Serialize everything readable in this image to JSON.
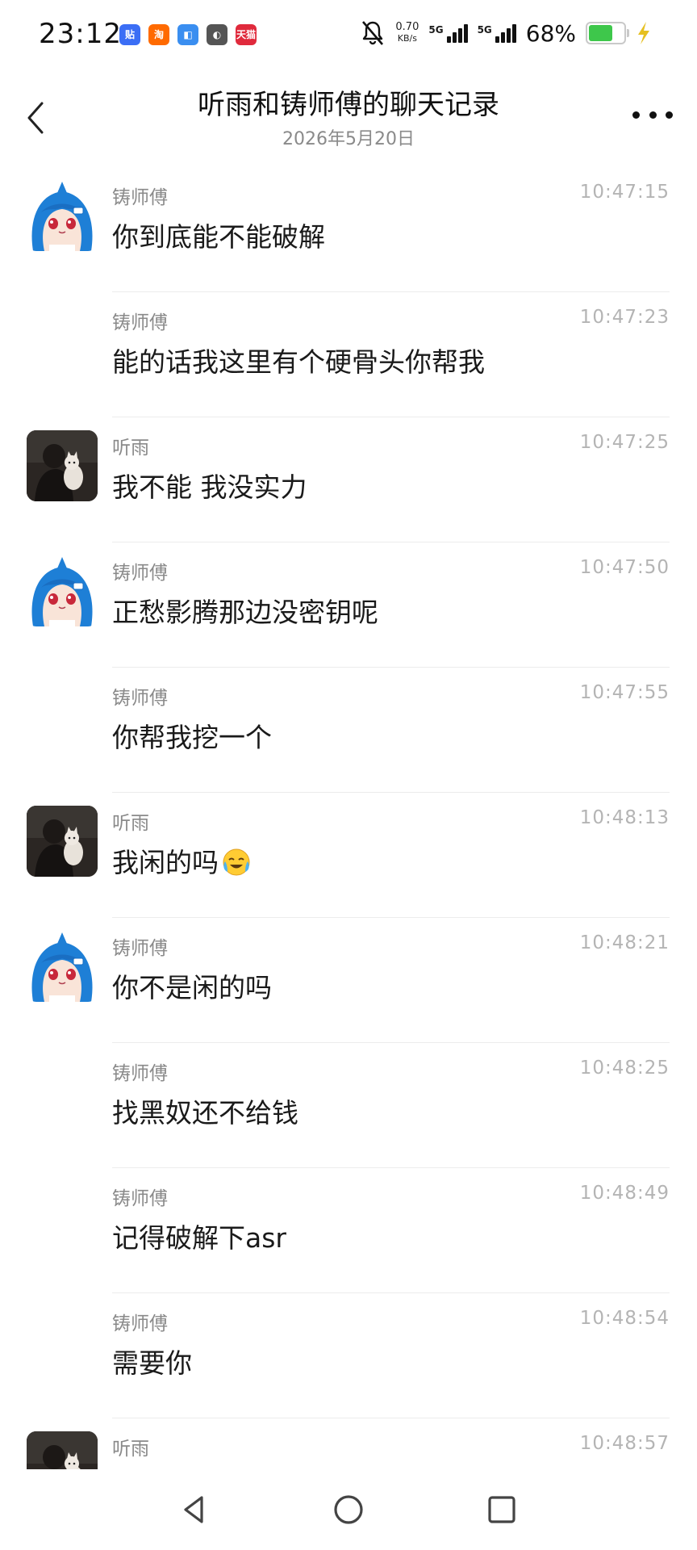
{
  "status_bar": {
    "time": "23:12",
    "apps": [
      {
        "label": "贴",
        "color": "#3b6ef5",
        "icon": "tieba-app-icon"
      },
      {
        "label": "淘",
        "color": "#ff6a00",
        "icon": "taobao-app-icon"
      },
      {
        "label": "◧",
        "color": "#3a8ef0",
        "icon": "message-app-icon"
      },
      {
        "label": "◐",
        "color": "#555555",
        "icon": "app-icon"
      },
      {
        "label": "天猫",
        "color": "#e02a3c",
        "icon": "tmall-app-icon"
      }
    ],
    "net_speed_value": "0.70",
    "net_speed_unit": "KB/s",
    "sim1_label": "5G",
    "sim2_label": "5G",
    "battery_percent": "68%",
    "battery_level": 0.68,
    "battery_color": "#3ec74b",
    "charging_color": "#e6c020"
  },
  "header": {
    "title": "听雨和铸师傅的聊天记录",
    "date": "2026年5月20日"
  },
  "messages": [
    {
      "sender": "铸师傅",
      "time": "10:47:15",
      "text": "你到底能不能破解",
      "avatar": "anime"
    },
    {
      "sender": "铸师傅",
      "time": "10:47:23",
      "text": "能的话我这里有个硬骨头你帮我",
      "avatar": ""
    },
    {
      "sender": "听雨",
      "time": "10:47:25",
      "text": "我不能 我没实力",
      "avatar": "photo"
    },
    {
      "sender": "铸师傅",
      "time": "10:47:50",
      "text": "正愁影腾那边没密钥呢",
      "avatar": "anime"
    },
    {
      "sender": "铸师傅",
      "time": "10:47:55",
      "text": "你帮我挖一个",
      "avatar": ""
    },
    {
      "sender": "听雨",
      "time": "10:48:13",
      "text": "我闲的吗",
      "emoji": "laughing-crying-emoji",
      "avatar": "photo"
    },
    {
      "sender": "铸师傅",
      "time": "10:48:21",
      "text": "你不是闲的吗",
      "avatar": "anime"
    },
    {
      "sender": "铸师傅",
      "time": "10:48:25",
      "text": "找黑奴还不给钱",
      "avatar": ""
    },
    {
      "sender": "铸师傅",
      "time": "10:48:49",
      "text": "记得破解下asr",
      "avatar": ""
    },
    {
      "sender": "铸师傅",
      "time": "10:48:54",
      "text": "需要你",
      "avatar": ""
    },
    {
      "sender": "听雨",
      "time": "10:48:57",
      "text": "",
      "avatar": "photo"
    }
  ]
}
